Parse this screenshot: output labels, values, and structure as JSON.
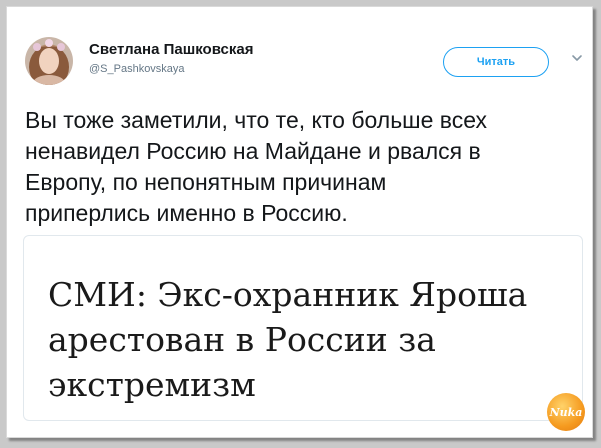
{
  "author": {
    "name": "Светлана Пашковская",
    "handle": "@S_Pashkovskaya"
  },
  "follow_button": {
    "label": "Читать"
  },
  "tweet": {
    "text_lines": [
      "Вы тоже заметили, что те, кто больше всех",
      "ненавидел Россию на Майдане и рвался в",
      "Европу, по непонятным причинам",
      "приперлись именно в Россию."
    ]
  },
  "card": {
    "title_lines": [
      "СМИ: Экс-охранник Яроша",
      "арестован в России за",
      "экстремизм"
    ]
  },
  "watermark": {
    "text": "Nuka"
  },
  "colors": {
    "accent": "#1da1f2",
    "background": "#c9c9c9"
  }
}
